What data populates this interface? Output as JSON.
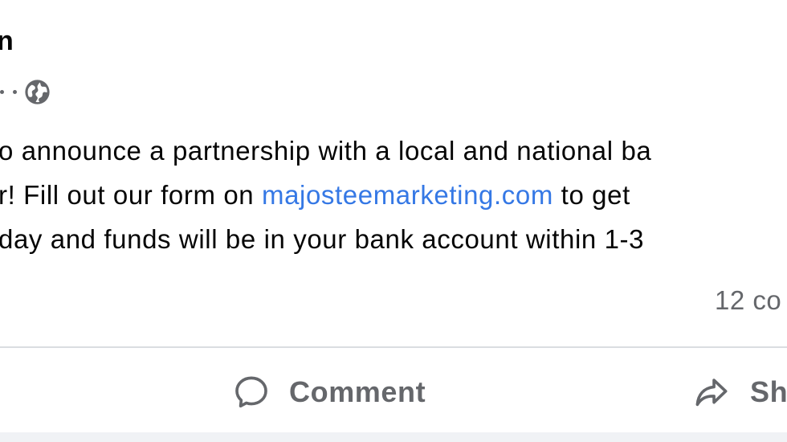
{
  "post": {
    "author_fragment": "n",
    "text_lines": [
      "o announce a partnership with a local and national ba",
      "r! Fill out our form on ",
      "day and funds will be in your bank account within 1-3"
    ],
    "link_text": "majosteemarketing.com",
    "line2_after_link": " to get",
    "comments_count": "12 co",
    "privacy_icon": "globe-icon"
  },
  "actions": {
    "comment_label": "Comment",
    "share_label": "Sh"
  },
  "colors": {
    "text": "#050505",
    "secondary": "#65676b",
    "link": "#3578e5",
    "divider": "#dadde1"
  }
}
